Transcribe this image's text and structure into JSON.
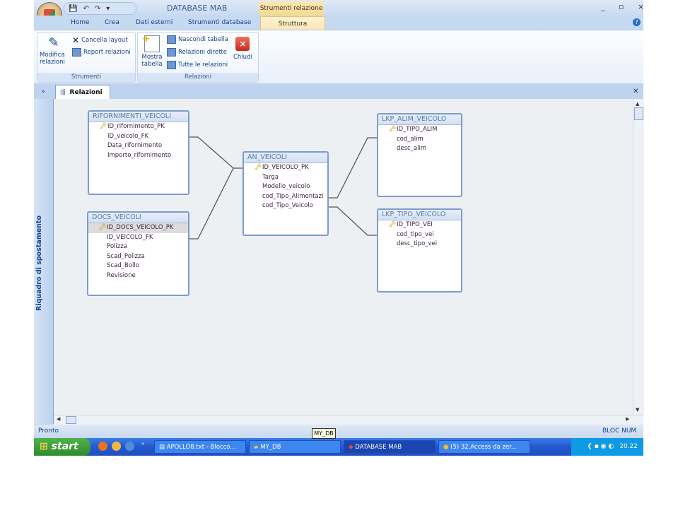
{
  "window": {
    "title": "DATABASE MAB",
    "context_tab_group": "Strumenti relazione",
    "controls": "_ ▫ ×"
  },
  "ribbon_tabs": [
    "Home",
    "Crea",
    "Dati esterni",
    "Strumenti database",
    "Struttura"
  ],
  "ribbon": {
    "strumenti": {
      "label": "Strumenti",
      "modifica": "Modifica relazioni",
      "cancella": "Cancella layout",
      "report": "Report relazioni"
    },
    "relazioni": {
      "label": "Relazioni",
      "mostra": "Mostra tabella",
      "nascondi": "Nascondi tabella",
      "dirette": "Relazioni dirette",
      "tutte": "Tutte le relazioni",
      "chiudi": "Chiudi"
    }
  },
  "document_tab": "Relazioni",
  "nav_pane_label": "Riquadro di spostamento",
  "tables": [
    {
      "name": "RIFORNIMENTI_VEICOLI",
      "fields": [
        "ID_rifornimento_PK",
        "ID_veicolo_FK",
        "Data_rifornimento",
        "Importo_rifornimento"
      ],
      "key": 0
    },
    {
      "name": "DOCS_VEICOLI",
      "fields": [
        "ID_DOCS_VEICOLO_PK",
        "ID_VEICOLO_FK",
        "Polizza",
        "Scad_Polizza",
        "Scad_Bollo",
        "Revisione"
      ],
      "key": 0
    },
    {
      "name": "AN_VEICOLI",
      "fields": [
        "ID_VEICOLO_PK",
        "Targa",
        "Modello_veicolo",
        "cod_Tipo_Alimentazi",
        "cod_Tipo_Veicolo"
      ],
      "key": 0
    },
    {
      "name": "LKP_ALIM_VEICOLO",
      "fields": [
        "ID_TIPO_ALIM",
        "cod_alim",
        "desc_alim"
      ],
      "key": 0
    },
    {
      "name": "LKP_TIPO_VEICOLO",
      "fields": [
        "ID_TIPO_VEI",
        "cod_tipo_vei",
        "desc_tipo_vei"
      ],
      "key": 0
    }
  ],
  "status": {
    "left": "Pronto",
    "right": "BLOC NUM",
    "tooltip": "MY_DB"
  },
  "taskbar": {
    "start": "start",
    "items": [
      "APOLLO8.txt - Blocco...",
      "MY_DB",
      "DATABASE MAB",
      "(5) 32.Access da zer..."
    ],
    "clock": "20.22"
  }
}
